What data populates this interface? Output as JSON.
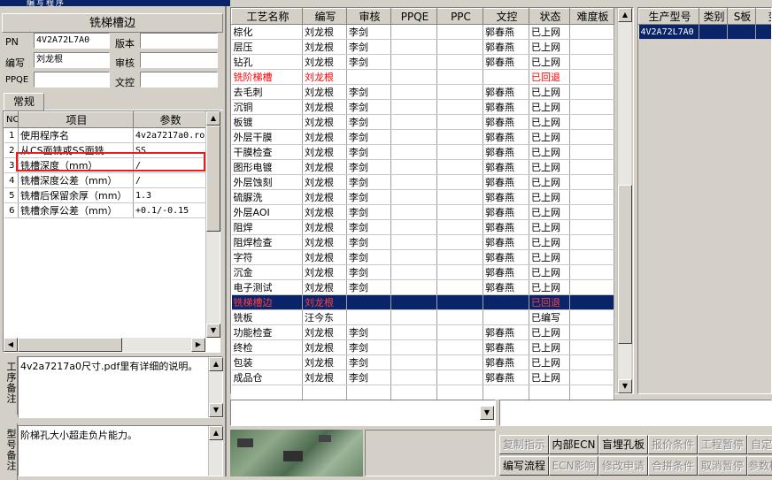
{
  "window": {
    "title": "编写程序"
  },
  "left": {
    "title": "铣梯槽边",
    "fields": {
      "pn_label": "PN",
      "pn_value": "4V2A72L7A0",
      "version_label": "版本",
      "version_value": "",
      "writer_label": "编写",
      "writer_value": "刘龙根",
      "review_label": "审核",
      "review_value": "",
      "ppqe_label": "PPQE",
      "ppqe_value": "",
      "doc_label": "文控",
      "doc_value": ""
    },
    "tab_label": "常规",
    "param_headers": [
      "NO",
      "项目",
      "参数"
    ],
    "params": [
      {
        "no": "1",
        "item": "使用程序名",
        "value": "4v2a7217a0.ro"
      },
      {
        "no": "2",
        "item": "从CS面铣或SS面铣",
        "value": "SS"
      },
      {
        "no": "3",
        "item": "铣槽深度（mm）",
        "value": "/"
      },
      {
        "no": "4",
        "item": "铣槽深度公差（mm）",
        "value": "/"
      },
      {
        "no": "5",
        "item": "铣槽后保留余厚（mm）",
        "value": "1.3"
      },
      {
        "no": "6",
        "item": "铣槽余厚公差（mm）",
        "value": "+0.1/-0.15"
      }
    ],
    "process_note_label": "工序备注",
    "process_note": "4v2a7217a0尺寸.pdf里有详细的说明。",
    "type_note_label": "型号备注",
    "type_note": "阶梯孔大小超走负片能力。"
  },
  "middle": {
    "headers": [
      "工艺名称",
      "编写",
      "审核",
      "PPQE",
      "PPC",
      "文控",
      "状态",
      "难度板"
    ],
    "rows": [
      {
        "name": "棕化",
        "writer": "刘龙根",
        "review": "李剑",
        "ppqe": "",
        "ppc": "",
        "doc": "郭春燕",
        "status": "已上网",
        "diff": ""
      },
      {
        "name": "层压",
        "writer": "刘龙根",
        "review": "李剑",
        "ppqe": "",
        "ppc": "",
        "doc": "郭春燕",
        "status": "已上网",
        "diff": ""
      },
      {
        "name": "钻孔",
        "writer": "刘龙根",
        "review": "李剑",
        "ppqe": "",
        "ppc": "",
        "doc": "郭春燕",
        "status": "已上网",
        "diff": ""
      },
      {
        "name": "铣阶梯槽",
        "writer": "刘龙根",
        "review": "",
        "ppqe": "",
        "ppc": "",
        "doc": "",
        "status": "已回退",
        "diff": "",
        "red": true
      },
      {
        "name": "去毛刺",
        "writer": "刘龙根",
        "review": "李剑",
        "ppqe": "",
        "ppc": "",
        "doc": "郭春燕",
        "status": "已上网",
        "diff": ""
      },
      {
        "name": "沉铜",
        "writer": "刘龙根",
        "review": "李剑",
        "ppqe": "",
        "ppc": "",
        "doc": "郭春燕",
        "status": "已上网",
        "diff": ""
      },
      {
        "name": "板镀",
        "writer": "刘龙根",
        "review": "李剑",
        "ppqe": "",
        "ppc": "",
        "doc": "郭春燕",
        "status": "已上网",
        "diff": ""
      },
      {
        "name": "外层干膜",
        "writer": "刘龙根",
        "review": "李剑",
        "ppqe": "",
        "ppc": "",
        "doc": "郭春燕",
        "status": "已上网",
        "diff": ""
      },
      {
        "name": "干膜检查",
        "writer": "刘龙根",
        "review": "李剑",
        "ppqe": "",
        "ppc": "",
        "doc": "郭春燕",
        "status": "已上网",
        "diff": ""
      },
      {
        "name": "图形电镀",
        "writer": "刘龙根",
        "review": "李剑",
        "ppqe": "",
        "ppc": "",
        "doc": "郭春燕",
        "status": "已上网",
        "diff": ""
      },
      {
        "name": "外层蚀刻",
        "writer": "刘龙根",
        "review": "李剑",
        "ppqe": "",
        "ppc": "",
        "doc": "郭春燕",
        "status": "已上网",
        "diff": ""
      },
      {
        "name": "硫脲洗",
        "writer": "刘龙根",
        "review": "李剑",
        "ppqe": "",
        "ppc": "",
        "doc": "郭春燕",
        "status": "已上网",
        "diff": ""
      },
      {
        "name": "外层AOI",
        "writer": "刘龙根",
        "review": "李剑",
        "ppqe": "",
        "ppc": "",
        "doc": "郭春燕",
        "status": "已上网",
        "diff": ""
      },
      {
        "name": "阻焊",
        "writer": "刘龙根",
        "review": "李剑",
        "ppqe": "",
        "ppc": "",
        "doc": "郭春燕",
        "status": "已上网",
        "diff": ""
      },
      {
        "name": "阻焊检查",
        "writer": "刘龙根",
        "review": "李剑",
        "ppqe": "",
        "ppc": "",
        "doc": "郭春燕",
        "status": "已上网",
        "diff": ""
      },
      {
        "name": "字符",
        "writer": "刘龙根",
        "review": "李剑",
        "ppqe": "",
        "ppc": "",
        "doc": "郭春燕",
        "status": "已上网",
        "diff": ""
      },
      {
        "name": "沉金",
        "writer": "刘龙根",
        "review": "李剑",
        "ppqe": "",
        "ppc": "",
        "doc": "郭春燕",
        "status": "已上网",
        "diff": ""
      },
      {
        "name": "电子测试",
        "writer": "刘龙根",
        "review": "李剑",
        "ppqe": "",
        "ppc": "",
        "doc": "郭春燕",
        "status": "已上网",
        "diff": ""
      },
      {
        "name": "铣梯槽边",
        "writer": "刘龙根",
        "review": "",
        "ppqe": "",
        "ppc": "",
        "doc": "",
        "status": "已回退",
        "diff": "",
        "red": true,
        "selected": true
      },
      {
        "name": "铣板",
        "writer": "汪今东",
        "review": "",
        "ppqe": "",
        "ppc": "",
        "doc": "",
        "status": "已编写",
        "diff": ""
      },
      {
        "name": "功能检查",
        "writer": "刘龙根",
        "review": "李剑",
        "ppqe": "",
        "ppc": "",
        "doc": "郭春燕",
        "status": "已上网",
        "diff": ""
      },
      {
        "name": "终检",
        "writer": "刘龙根",
        "review": "李剑",
        "ppqe": "",
        "ppc": "",
        "doc": "郭春燕",
        "status": "已上网",
        "diff": ""
      },
      {
        "name": "包装",
        "writer": "刘龙根",
        "review": "李剑",
        "ppqe": "",
        "ppc": "",
        "doc": "郭春燕",
        "status": "已上网",
        "diff": ""
      },
      {
        "name": "成品仓",
        "writer": "刘龙根",
        "review": "李剑",
        "ppqe": "",
        "ppc": "",
        "doc": "郭春燕",
        "status": "已上网",
        "diff": ""
      }
    ]
  },
  "right": {
    "headers": [
      "生产型号",
      "类别",
      "S板",
      "变"
    ],
    "rows": [
      {
        "model": "4V2A72L7A0",
        "type": "",
        "s": ""
      }
    ]
  },
  "bottom": {
    "combo_value": "",
    "buttons_row1": [
      {
        "label": "复制指示",
        "enabled": false
      },
      {
        "label": "内部ECN",
        "enabled": true
      },
      {
        "label": "盲埋孔板",
        "enabled": true
      },
      {
        "label": "报价条件",
        "enabled": false
      },
      {
        "label": "工程暂停",
        "enabled": false
      },
      {
        "label": "自定义",
        "enabled": false
      }
    ],
    "buttons_row2": [
      {
        "label": "编写流程",
        "enabled": true
      },
      {
        "label": "ECN影响",
        "enabled": false
      },
      {
        "label": "修改申请",
        "enabled": false
      },
      {
        "label": "合拼条件",
        "enabled": false
      },
      {
        "label": "取消暂停",
        "enabled": false
      },
      {
        "label": "参数模板",
        "enabled": false
      }
    ]
  }
}
